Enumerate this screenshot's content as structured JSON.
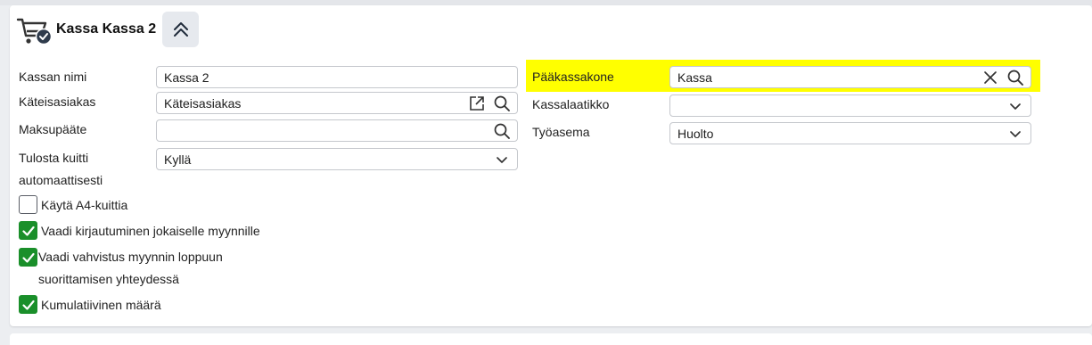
{
  "header": {
    "title": "Kassa Kassa 2",
    "icon": "shopping-cart-check-icon",
    "collapse_icon": "chevron-double-up-icon"
  },
  "left": {
    "kassan_nimi": {
      "label": "Kassan nimi",
      "value": "Kassa 2"
    },
    "kateisasiakas": {
      "label": "Käteisasiakas",
      "value": "Käteisasiakas"
    },
    "maksupaate": {
      "label": "Maksupääte",
      "value": ""
    },
    "tulosta_kuitti": {
      "label_line1": "Tulosta kuitti",
      "label_line2": "automaattisesti",
      "value": "Kyllä"
    }
  },
  "right": {
    "paakassakone": {
      "label": "Pääkassakone",
      "value": "Kassa"
    },
    "kassalaatikko": {
      "label": "Kassalaatikko",
      "value": ""
    },
    "tyoasema": {
      "label": "Työasema",
      "value": "Huolto"
    }
  },
  "checkboxes": [
    {
      "label": "Käytä A4-kuittia",
      "checked": false
    },
    {
      "label": "Vaadi kirjautuminen jokaiselle myynnille",
      "checked": true
    },
    {
      "label_line1": "Vaadi vahvistus myynnin loppuun",
      "label_line2": "suorittamisen yhteydessä",
      "checked": true
    },
    {
      "label": "Kumulatiivinen määrä",
      "checked": true
    }
  ],
  "colors": {
    "highlight": "#ffff00",
    "checkbox_checked": "#1a8f2a",
    "field_border": "#c5c8cd"
  }
}
